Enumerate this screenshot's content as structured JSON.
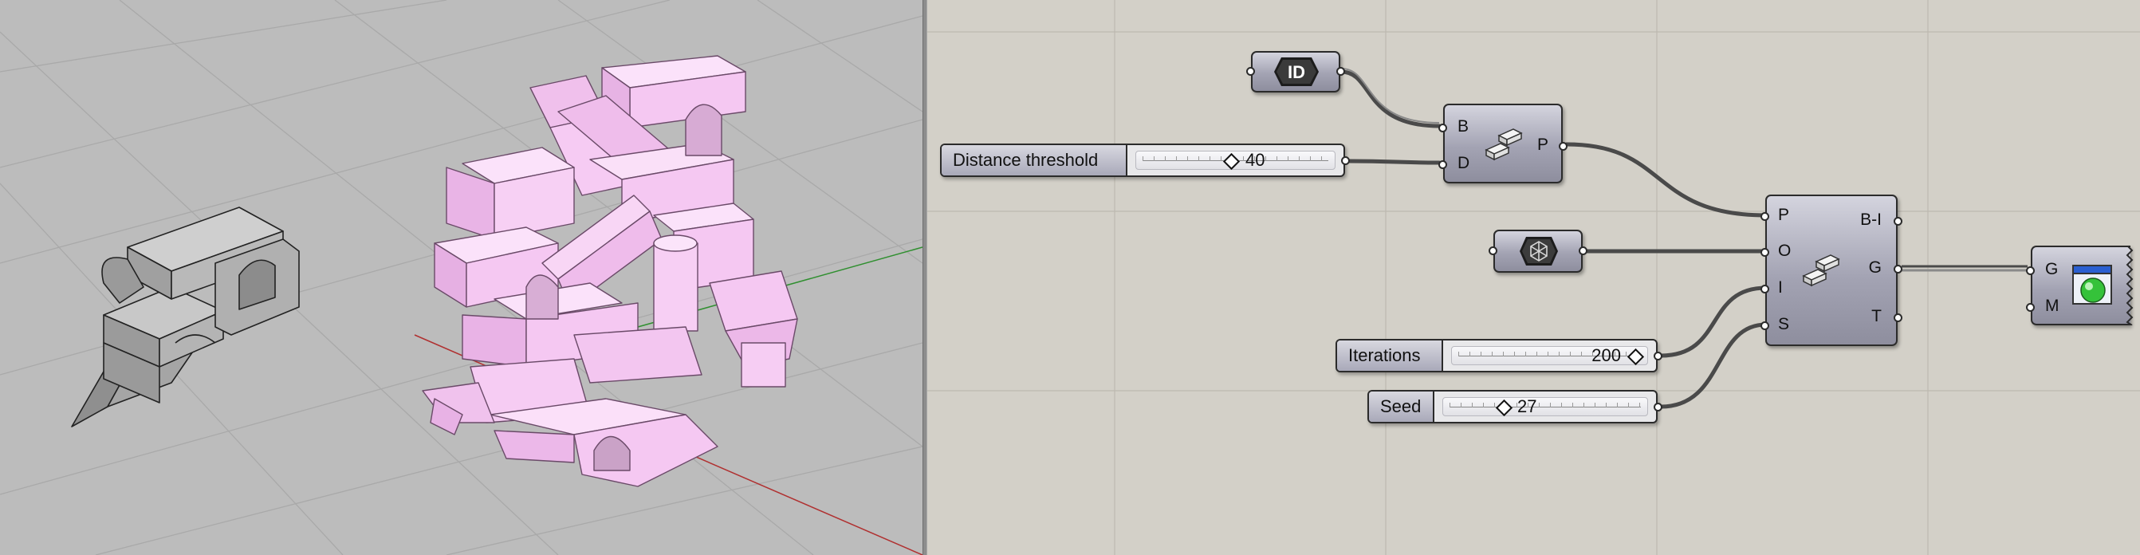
{
  "canvas": {
    "id_param": {
      "icon": "id-icon",
      "label": "ID"
    },
    "distance_slider": {
      "label": "Distance threshold",
      "value": "40"
    },
    "iterations_slider": {
      "label": "Iterations",
      "value": "200"
    },
    "seed_slider": {
      "label": "Seed",
      "value": "27"
    },
    "blocks_component": {
      "icon": "blocks-icon",
      "inputs": [
        "B",
        "D"
      ],
      "outputs": [
        "P"
      ]
    },
    "geometry_param": {
      "icon": "geometry-param-icon"
    },
    "assembly_component": {
      "icon": "blocks-icon",
      "inputs": [
        "P",
        "O",
        "I",
        "S"
      ],
      "outputs": [
        "B-I",
        "G",
        "T"
      ]
    },
    "preview_component": {
      "icon": "preview-sphere-icon",
      "inputs": [
        "G",
        "M"
      ]
    }
  },
  "viewport": {
    "highlight_color": "#f5c8f2",
    "object_color": "#a8a8a8",
    "x_axis_color": "#b03030",
    "y_axis_color": "#2f8f2f"
  }
}
